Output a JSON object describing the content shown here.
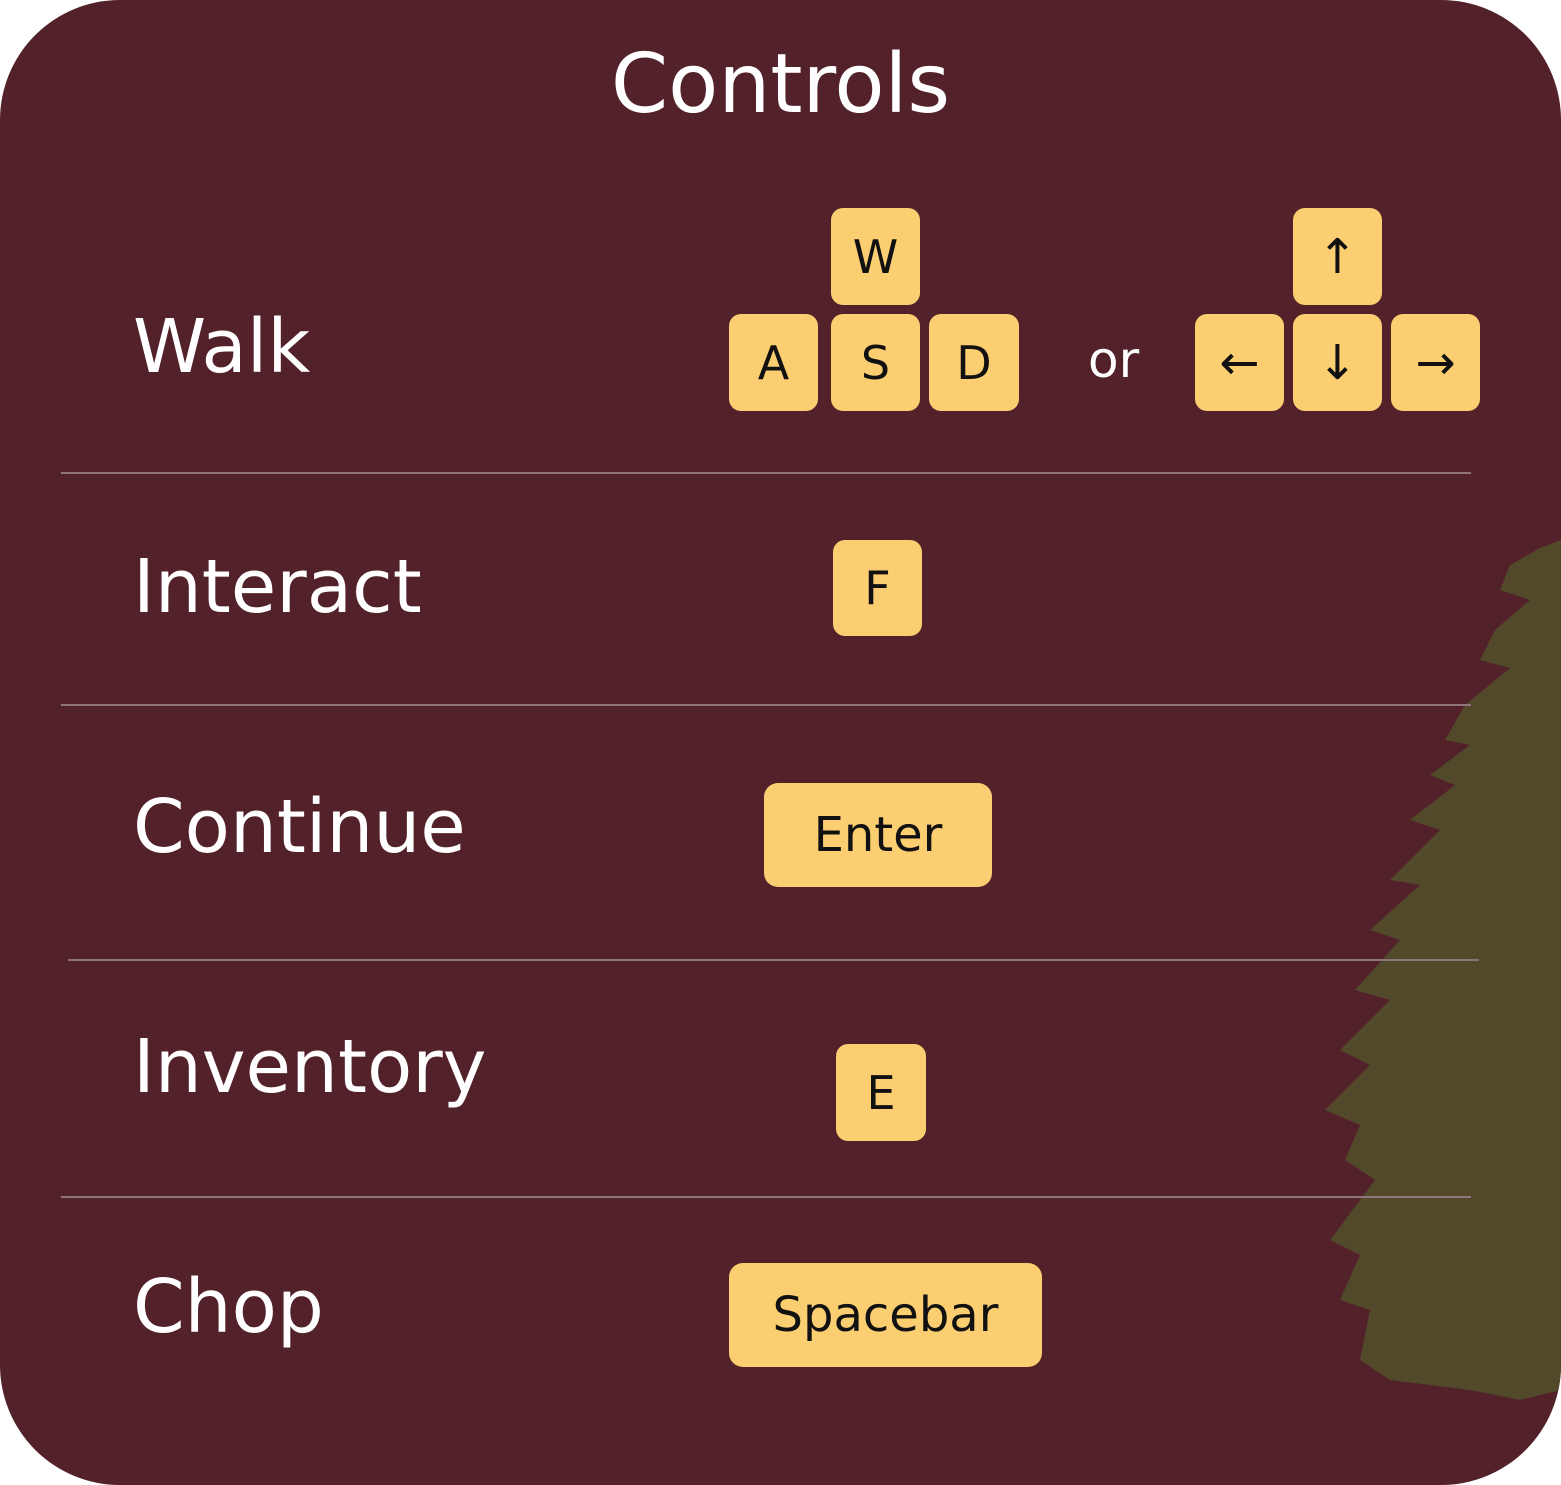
{
  "title": "Controls",
  "rows": [
    {
      "label": "Walk"
    },
    {
      "label": "Interact"
    },
    {
      "label": "Continue"
    },
    {
      "label": "Inventory"
    },
    {
      "label": "Chop"
    }
  ],
  "walk": {
    "wasd": {
      "up": "W",
      "left": "A",
      "down": "S",
      "right": "D"
    },
    "separator": "or",
    "arrows": {
      "up": "↑",
      "left": "←",
      "down": "↓",
      "right": "→"
    }
  },
  "keys": {
    "interact": "F",
    "continue": "Enter",
    "inventory": "E",
    "chop": "Spacebar"
  },
  "colors": {
    "panel": "#52212a",
    "key": "#fcce72",
    "tree": "#52482a",
    "text": "#ffffff"
  }
}
